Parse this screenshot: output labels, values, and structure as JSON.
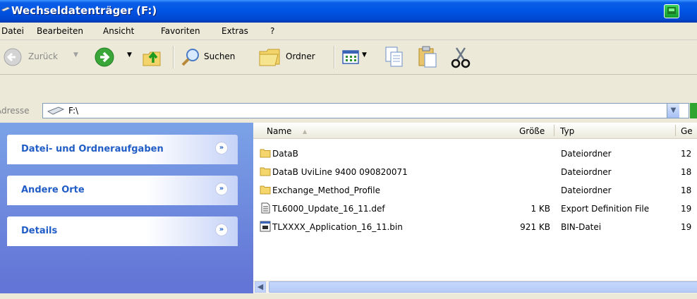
{
  "window": {
    "title": "Wechseldatenträger (F:)"
  },
  "menu": [
    "Datei",
    "Bearbeiten",
    "Ansicht",
    "Favoriten",
    "Extras",
    "?"
  ],
  "toolbar": {
    "back_label": "Zurück",
    "search_label": "Suchen",
    "folders_label": "Ordner"
  },
  "address": {
    "label": "Adresse",
    "value": "F:\\"
  },
  "tasks": [
    {
      "title": "Datei- und Ordneraufgaben"
    },
    {
      "title": "Andere Orte"
    },
    {
      "title": "Details"
    }
  ],
  "columns": {
    "name": "Name",
    "size": "Größe",
    "type": "Typ",
    "date": "Ge"
  },
  "files": [
    {
      "name": "DataB",
      "size": "",
      "type": "Dateiordner",
      "date": "12",
      "icon": "folder-icon"
    },
    {
      "name": "DataB UviLine 9400 090820071",
      "size": "",
      "type": "Dateiordner",
      "date": "18",
      "icon": "folder-icon"
    },
    {
      "name": "Exchange_Method_Profile",
      "size": "",
      "type": "Dateiordner",
      "date": "18",
      "icon": "folder-icon"
    },
    {
      "name": "TL6000_Update_16_11.def",
      "size": "1 KB",
      "type": "Export Definition File",
      "date": "19",
      "icon": "text-file-icon"
    },
    {
      "name": "TLXXXX_Application_16_11.bin",
      "size": "921 KB",
      "type": "BIN-Datei",
      "date": "19",
      "icon": "binary-file-icon"
    }
  ],
  "colors": {
    "titlebar": "#0054e3",
    "taskpane": "#6f8fdf",
    "task_title": "#215dc6"
  }
}
